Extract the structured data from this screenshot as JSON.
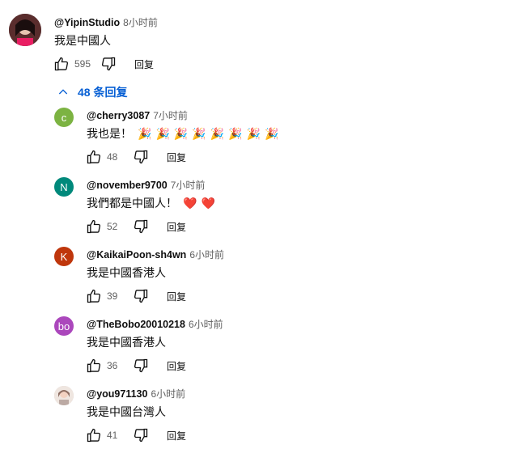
{
  "comment": {
    "handle": "@YipinStudio",
    "time": "8小时前",
    "text": "我是中國人",
    "likes": "595",
    "reply_label": "回复"
  },
  "replies_toggle": {
    "label": "48 条回复",
    "color": "#065fd4"
  },
  "replies": [
    {
      "avatar_letter": "c",
      "avatar_color": "#7cb342",
      "handle": "@cherry3087",
      "time": "7小时前",
      "text": "我也是！",
      "emojis": [
        "🎉",
        "🎉",
        "🎉",
        "🎉",
        "🎉",
        "🎉",
        "🎉",
        "🎉"
      ],
      "likes": "48",
      "reply_label": "回复"
    },
    {
      "avatar_letter": "N",
      "avatar_color": "#00897b",
      "handle": "@november9700",
      "time": "7小时前",
      "text": "我們都是中國人！",
      "emojis": [
        "❤️",
        "❤️"
      ],
      "likes": "52",
      "reply_label": "回复"
    },
    {
      "avatar_letter": "K",
      "avatar_color": "#bf360c",
      "handle": "@KaikaiPoon-sh4wn",
      "time": "6小时前",
      "text": "我是中國香港人",
      "emojis": [],
      "likes": "39",
      "reply_label": "回复"
    },
    {
      "avatar_letter": "bo",
      "avatar_color": "#ab47bc",
      "handle": "@TheBobo20010218",
      "time": "6小时前",
      "text": "我是中國香港人",
      "emojis": [],
      "likes": "36",
      "reply_label": "回复"
    },
    {
      "avatar_letter": "",
      "avatar_color": "#d7ccc8",
      "handle": "@you971130",
      "time": "6小时前",
      "text": "我是中國台灣人",
      "emojis": [],
      "likes": "41",
      "reply_label": "回复"
    }
  ]
}
